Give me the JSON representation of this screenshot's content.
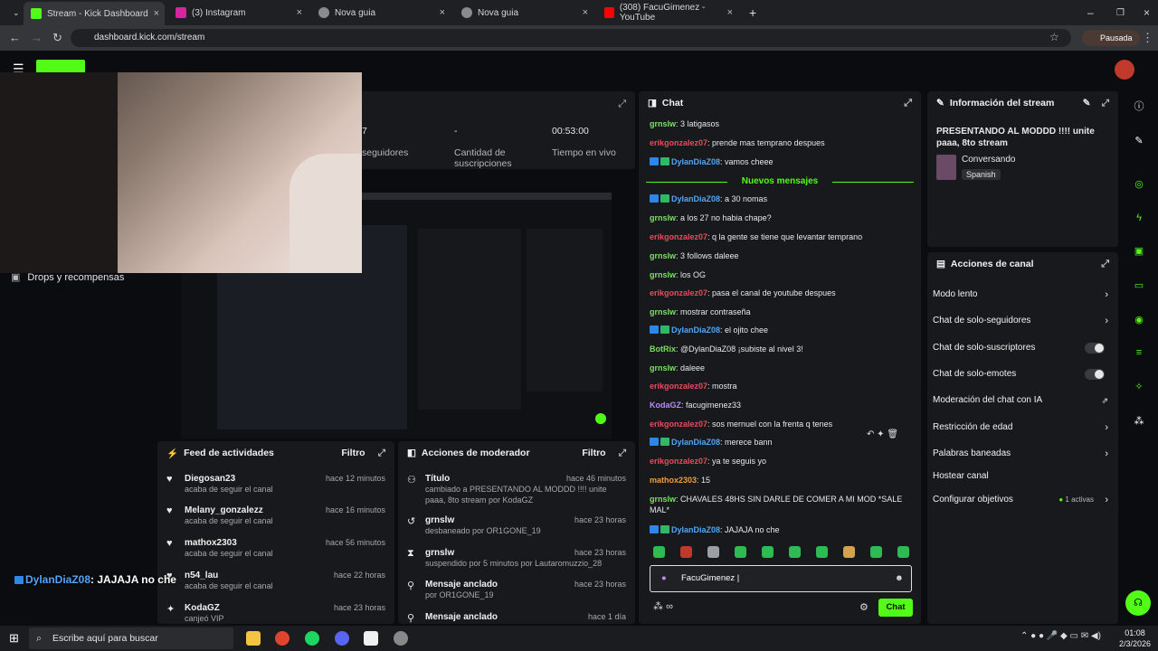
{
  "browser": {
    "tabs": [
      {
        "title": "Stream - Kick Dashboard"
      },
      {
        "title": "(3) Instagram"
      },
      {
        "title": "Nova guia"
      },
      {
        "title": "Nova guia"
      },
      {
        "title": "(308) FacuGimenez - YouTube"
      }
    ],
    "url": "dashboard.kick.com/stream",
    "profile": "Pausada"
  },
  "stats": {
    "followers_value": "7",
    "followers_label": "seguidores",
    "subs_value": "-",
    "subs_label": "Cantidad de suscripciones",
    "time_value": "00:53:00",
    "time_label": "Tiempo en vivo"
  },
  "sidebar": {
    "drops_label": "Drops y recompensas"
  },
  "chat": {
    "title": "Chat",
    "new_messages": "Nuevos mensajes",
    "messages": [
      {
        "user": "grnslw",
        "text": ": 3 latigasos",
        "color": "green"
      },
      {
        "user": "erikgonzalez07",
        "text": ": prende mas temprano despues",
        "color": "red"
      },
      {
        "user": "DylanDiaZ08",
        "text": ": vamos cheee",
        "color": "blue"
      },
      {
        "user": "DylanDiaZ08",
        "text": ": a 30 nomas",
        "color": "blue"
      },
      {
        "user": "grnslw",
        "text": ": a los 27 no habia chape?",
        "color": "green"
      },
      {
        "user": "erikgonzalez07",
        "text": ": q la gente se tiene que levantar temprano",
        "color": "red"
      },
      {
        "user": "grnslw",
        "text": ": 3 follows daleee",
        "color": "green"
      },
      {
        "user": "grnslw",
        "text": ": los OG",
        "color": "green"
      },
      {
        "user": "erikgonzalez07",
        "text": ": pasa el canal de youtube despues",
        "color": "red"
      },
      {
        "user": "grnslw",
        "text": ": mostrar contraseña",
        "color": "green"
      },
      {
        "user": "DylanDiaZ08",
        "text": ": el ojito chee",
        "color": "blue"
      },
      {
        "user": "BotRix",
        "text": ": @DylanDiaZ08 ¡subiste al nivel 3!",
        "color": "green"
      },
      {
        "user": "grnslw",
        "text": ": daleee",
        "color": "green"
      },
      {
        "user": "erikgonzalez07",
        "text": ": mostra",
        "color": "red"
      },
      {
        "user": "KodaGZ",
        "text": ": facugimenez33",
        "color": "purple"
      },
      {
        "user": "erikgonzalez07",
        "text": ": sos mernuel con la frenta q tenes",
        "color": "red"
      },
      {
        "user": "DylanDiaZ08",
        "text": ": merece bann",
        "color": "blue"
      },
      {
        "user": "erikgonzalez07",
        "text": ": ya te seguis yo",
        "color": "red"
      },
      {
        "user": "mathox2303",
        "text": ": 15",
        "color": "orange"
      },
      {
        "user": "grnslw",
        "text": ": CHAVALES 48HS SIN DARLE DE COMER A MI MOD *SALE MAL*",
        "color": "green"
      },
      {
        "user": "DylanDiaZ08",
        "text": ": JAJAJA no che",
        "color": "blue"
      }
    ],
    "input_value": "FacuGimenez |",
    "send_label": "Chat",
    "points_label": "∞"
  },
  "stream_info": {
    "title": "Información del stream",
    "stream_title": "PRESENTANDO AL MODDD !!!! unite paaa, 8to stream",
    "category": "Conversando",
    "language": "Spanish"
  },
  "channel_actions": {
    "title": "Acciones de canal",
    "items": [
      {
        "label": "Modo lento",
        "control": "chevron"
      },
      {
        "label": "Chat de solo-seguidores",
        "control": "chevron"
      },
      {
        "label": "Chat de solo-suscriptores",
        "control": "toggle"
      },
      {
        "label": "Chat de solo-emotes",
        "control": "toggle"
      },
      {
        "label": "Moderación del chat con IA",
        "control": "external"
      },
      {
        "label": "Restricción de edad",
        "control": "chevron"
      },
      {
        "label": "Palabras baneadas",
        "control": "chevron"
      },
      {
        "label": "Hostear canal",
        "control": "none"
      },
      {
        "label": "Configurar objetivos",
        "control": "chevron"
      }
    ],
    "goals_active": "1 activas"
  },
  "feed": {
    "title": "Feed de actividades",
    "filter": "Filtro",
    "items": [
      {
        "name": "Diegosan23",
        "sub": "acaba de seguir el canal",
        "time": "hace 12 minutos"
      },
      {
        "name": "Melany_gonzalezz",
        "sub": "acaba de seguir el canal",
        "time": "hace 16 minutos"
      },
      {
        "name": "mathox2303",
        "sub": "acaba de seguir el canal",
        "time": "hace 56 minutos"
      },
      {
        "name": "n54_lau",
        "sub": "acaba de seguir el canal",
        "time": "hace 22 horas"
      },
      {
        "name": "KodaGZ",
        "sub": "canjeó VIP",
        "time": "hace 23 horas"
      }
    ]
  },
  "mod_actions": {
    "title": "Acciones de moderador",
    "filter": "Filtro",
    "items": [
      {
        "name": "Título",
        "sub": "cambiado a PRESENTANDO AL MODDD !!!! unite paaa, 8to stream por KodaGZ",
        "time": "hace 46 minutos"
      },
      {
        "name": "grnslw",
        "sub": "desbaneado por OR1GONE_19",
        "time": "hace 23 horas"
      },
      {
        "name": "grnslw",
        "sub": "suspendido por 5 minutos por Lautaromuzzio_28",
        "time": "hace 23 horas"
      },
      {
        "name": "Mensaje anclado",
        "sub": "por OR1GONE_19",
        "time": "hace 23 horas"
      },
      {
        "name": "Mensaje anclado",
        "sub": "",
        "time": "hace 1 día"
      }
    ]
  },
  "overlay": {
    "user": "DylanDiaZ08",
    "text": ": JAJAJA no che"
  },
  "taskbar": {
    "search_placeholder": "Escribe aquí para buscar",
    "time": "01:08",
    "date": "2/3/2026"
  },
  "colors": {
    "accent": "#53fc18",
    "panel": "#18191c",
    "bg": "#0b0c0f"
  }
}
